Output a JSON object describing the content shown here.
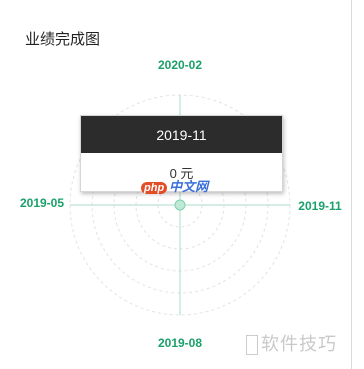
{
  "page": {
    "title": "业绩完成图"
  },
  "chart_data": {
    "type": "radar",
    "indicators": [
      "2020-02",
      "2019-11",
      "2019-08",
      "2019-05"
    ],
    "series": [
      {
        "values": [
          0,
          0,
          0,
          0
        ]
      }
    ],
    "rings": 5,
    "colors": {
      "axis_label": "#1aa06a",
      "line": "#a8dcc8",
      "grid": "#e3e3e3"
    }
  },
  "tooltip": {
    "header": "2019-11",
    "value": "0 元"
  },
  "watermarks": {
    "site_php": "php",
    "site_cn": "中文网",
    "corner": "软件技巧"
  }
}
